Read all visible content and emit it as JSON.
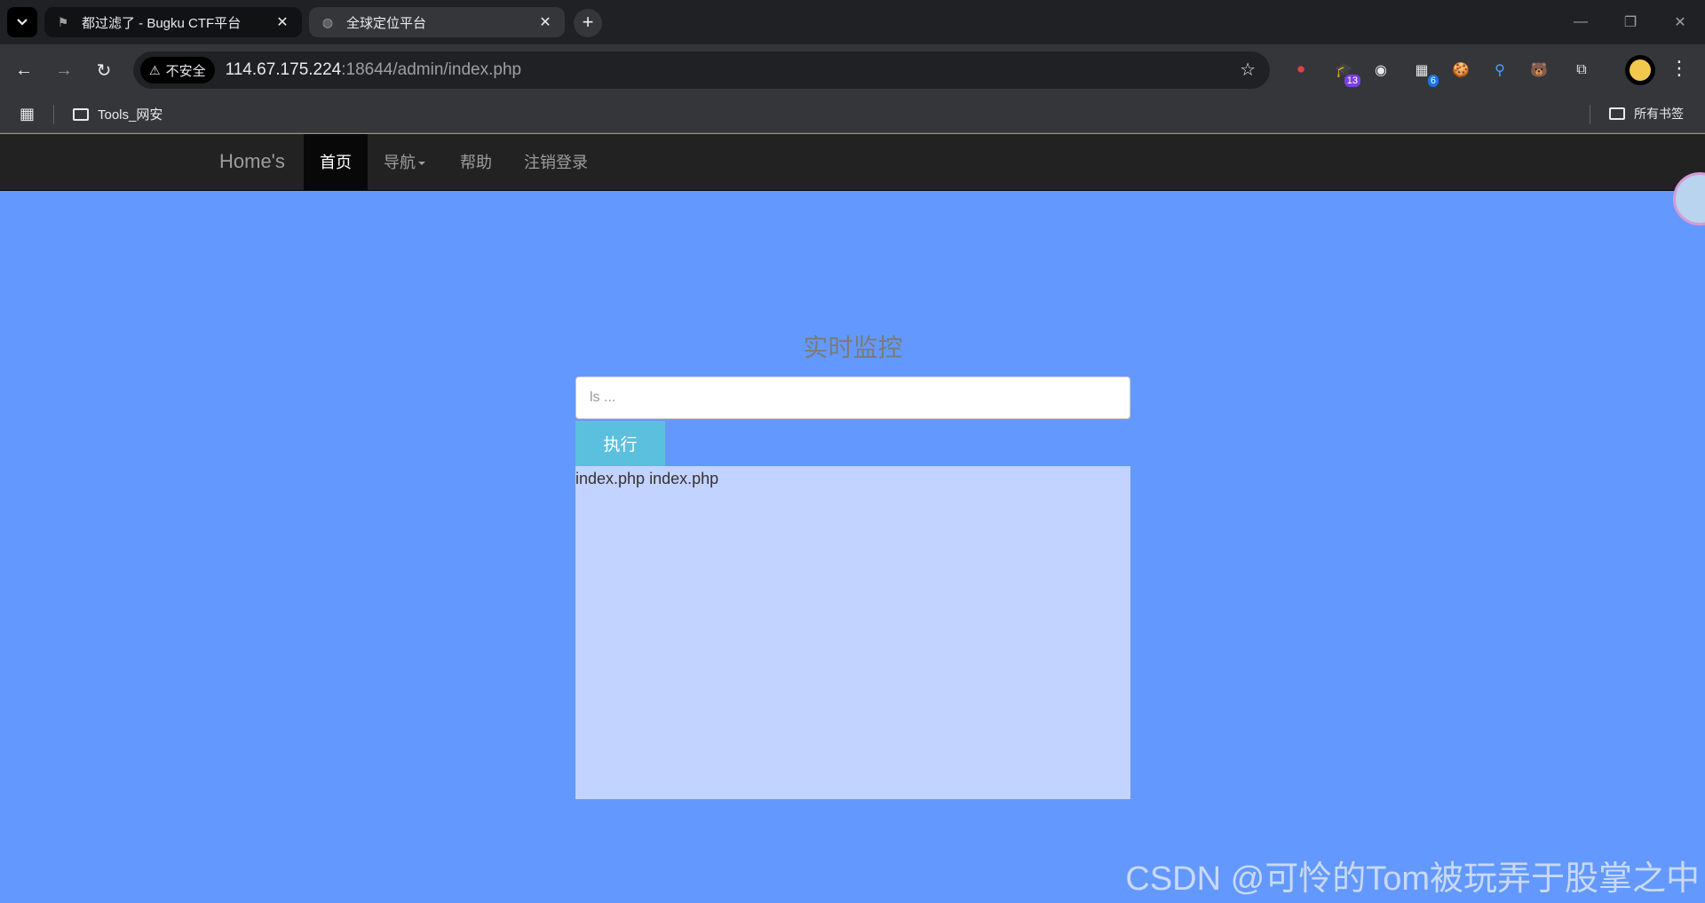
{
  "browser": {
    "tabs": [
      {
        "title": "都过滤了 - Bugku CTF平台",
        "favicon": "flag-icon",
        "active": false
      },
      {
        "title": "全球定位平台",
        "favicon": "globe-icon",
        "active": true
      }
    ],
    "new_tab": "+",
    "window_controls": {
      "minimize": "—",
      "restore": "❐",
      "close": "✕"
    },
    "back": "←",
    "forward": "→",
    "reload": "↻",
    "security_label": "不安全",
    "security_icon": "⚠",
    "url_host": "114.67.175.224",
    "url_rest": ":18644/admin/index.php",
    "bookmark_star": "☆",
    "extensions": [
      {
        "name": "record-icon",
        "glyph": "⏺",
        "badge": ""
      },
      {
        "name": "graduation-cap-icon",
        "glyph": "🎓",
        "badge": "13"
      },
      {
        "name": "ring-icon",
        "glyph": "◉",
        "badge": ""
      },
      {
        "name": "grid-extension-icon",
        "glyph": "▦",
        "badge": "6"
      },
      {
        "name": "cookie-icon",
        "glyph": "🍪",
        "badge": ""
      },
      {
        "name": "pin-icon",
        "glyph": "⚲",
        "badge": ""
      },
      {
        "name": "bear-icon",
        "glyph": "🐻",
        "badge": ""
      },
      {
        "name": "puzzle-icon",
        "glyph": "⧉",
        "badge": ""
      }
    ],
    "menu": "⋮",
    "bookmarks": {
      "apps_icon": "▦",
      "folder_tools": "Tools_网安",
      "folder_all": "所有书签"
    }
  },
  "site": {
    "brand": "Home's",
    "nav": [
      {
        "label": "首页",
        "active": true
      },
      {
        "label": "导航",
        "dropdown": true
      },
      {
        "label": "帮助"
      },
      {
        "label": "注销登录"
      }
    ],
    "heading": "实时监控",
    "command_placeholder": "ls ...",
    "command_value": "",
    "execute_label": "执行",
    "output_text": "index.php index.php"
  },
  "watermark": "CSDN @可怜的Tom被玩弄于股掌之中",
  "colors": {
    "page_bg": "#6399fe",
    "navbar_bg": "#222222",
    "button_bg": "#5bc0de",
    "output_bg": "#c3d3ff"
  }
}
